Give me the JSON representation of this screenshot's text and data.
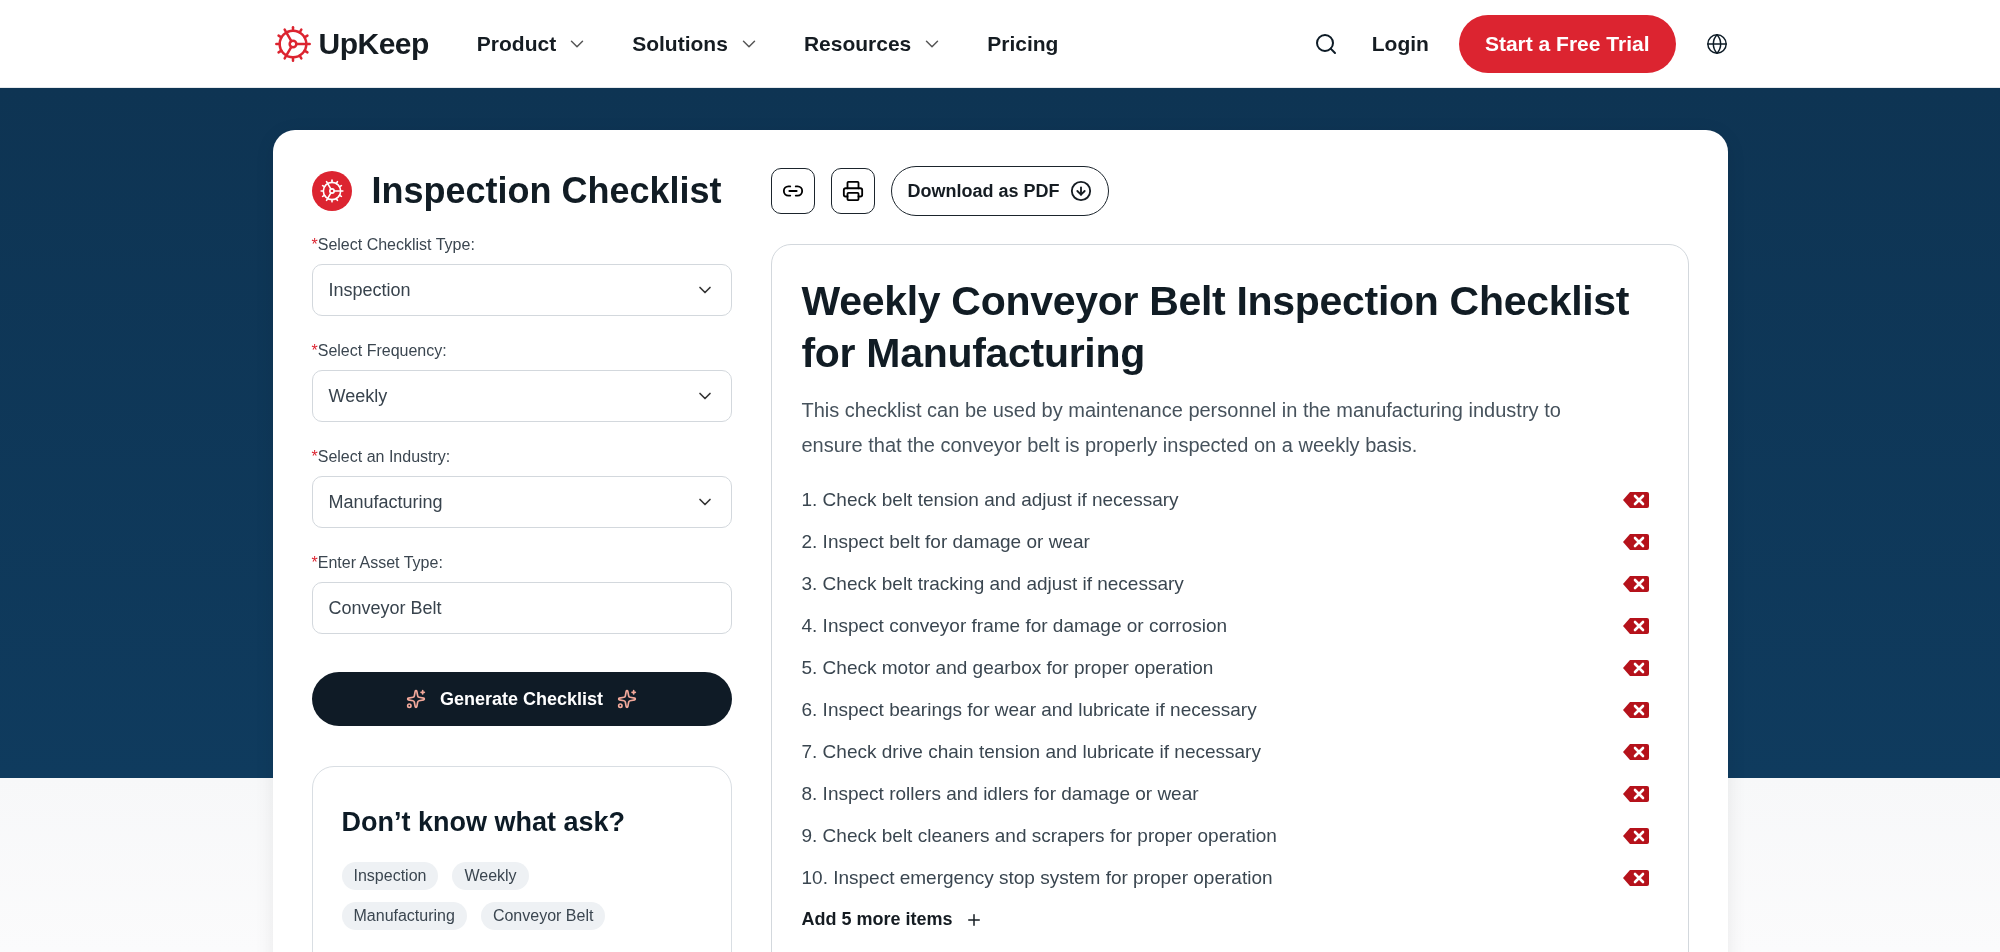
{
  "nav": {
    "brand": "UpKeep",
    "menu": [
      {
        "label": "Product",
        "dropdown": true
      },
      {
        "label": "Solutions",
        "dropdown": true
      },
      {
        "label": "Resources",
        "dropdown": true
      },
      {
        "label": "Pricing",
        "dropdown": false
      }
    ],
    "login": "Login",
    "cta": "Start a Free Trial"
  },
  "generator": {
    "title": "Inspection Checklist",
    "fields": [
      {
        "kind": "select",
        "mark": "*",
        "label": "Select Checklist Type:",
        "value": "Inspection"
      },
      {
        "kind": "select",
        "mark": "*",
        "label": "Select Frequency:",
        "value": "Weekly"
      },
      {
        "kind": "select",
        "mark": "*",
        "label": "Select an Industry:",
        "value": "Manufacturing"
      },
      {
        "kind": "text",
        "mark": "*",
        "label": "Enter Asset Type:",
        "value": "Conveyor Belt"
      }
    ],
    "button": "Generate Checklist",
    "help": {
      "title": "Don’t know what ask?",
      "tags": [
        "Inspection",
        "Weekly",
        "Manufacturing",
        "Conveyor Belt"
      ]
    }
  },
  "preview": {
    "download": "Download as PDF",
    "title": "Weekly Conveyor Belt Inspection Checklist for Manufacturing",
    "description": "This checklist can be used by maintenance personnel in the manufacturing industry to ensure that the conveyor belt is properly inspected on a weekly basis.",
    "items": [
      "1. Check belt tension and adjust if necessary",
      "2. Inspect belt for damage or wear",
      "3. Check belt tracking and adjust if necessary",
      "4. Inspect conveyor frame for damage or corrosion",
      "5. Check motor and gearbox for proper operation",
      "6. Inspect bearings for wear and lubricate if necessary",
      "7. Check drive chain tension and lubricate if necessary",
      "8. Inspect rollers and idlers for damage or wear",
      "9. Check belt cleaners and scrapers for proper operation",
      "10. Inspect emergency stop system for proper operation"
    ],
    "add_more": "Add 5 more items"
  }
}
